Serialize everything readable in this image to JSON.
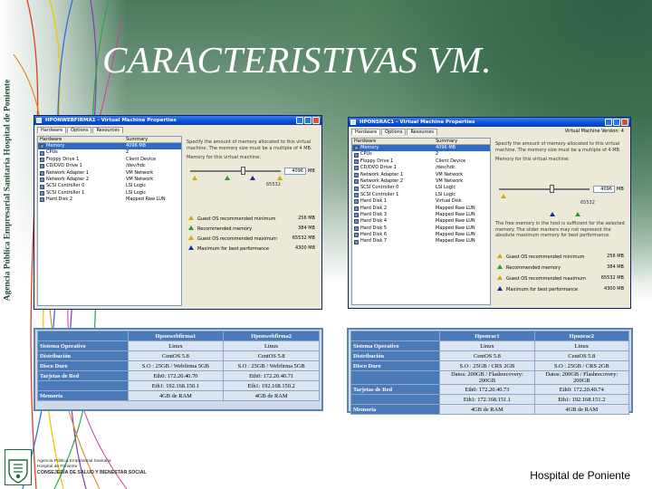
{
  "slide": {
    "title": "CARACTERISTIVAS VM.",
    "vertical_caption": "Agencia Pública Empresarial Sanitaria Hospital de Poniente",
    "footer_right": "Hospital de Poniente",
    "logo": {
      "line1": "Agencia Pública Empresarial Sanitaria",
      "line2": "Hospital de Poniente",
      "line3": "CONSEJERÍA DE SALUD Y BIENESTAR SOCIAL"
    },
    "colors": {
      "background_green": "#3c6e50",
      "table_header_blue": "#4a7ab8",
      "xp_titlebar_blue": "#0a4fd4"
    }
  },
  "vm_left": {
    "window_title": "HPONWEBFIRMA1 - Virtual Machine Properties",
    "tabs": [
      "Hardware",
      "Options",
      "Resources"
    ],
    "columns": [
      "Hardware",
      "Summary"
    ],
    "devices": [
      {
        "name": "Memory",
        "summary": "4096 MB",
        "icon": "memory-icon"
      },
      {
        "name": "CPUs",
        "summary": "2",
        "icon": "cpu-icon"
      },
      {
        "name": "Floppy Drive 1",
        "summary": "Client Device",
        "icon": "floppy-icon"
      },
      {
        "name": "CD/DVD Drive 1",
        "summary": "/dev/hdc",
        "icon": "cdrom-icon"
      },
      {
        "name": "Network Adapter 1",
        "summary": "VM Network",
        "icon": "network-icon"
      },
      {
        "name": "Network Adapter 2",
        "summary": "VM Network",
        "icon": "network-icon"
      },
      {
        "name": "SCSI Controller 0",
        "summary": "LSI Logic",
        "icon": "controller-icon"
      },
      {
        "name": "SCSI Controller 1",
        "summary": "LSI Logic",
        "icon": "controller-icon"
      },
      {
        "name": "Hard Disk 2",
        "summary": "Mapped Raw LUN",
        "icon": "harddisk-icon"
      }
    ],
    "memory_description": "Specify the amount of memory allocated to this virtual machine. The memory size must be a multiple of 4 MB.",
    "memory_for_vm_label": "Memory for this virtual machine:",
    "memory_value": "4096",
    "memory_unit": "MB",
    "slider_max_label": "65532",
    "legend": [
      {
        "label": "Guest OS recommended minimum",
        "value": "256 MB",
        "color": "#c9b000"
      },
      {
        "label": "Recommended memory",
        "value": "384 MB",
        "color": "#2f9b2f"
      },
      {
        "label": "Guest OS recommended maximum",
        "value": "65532 MB",
        "color": "#c9b000"
      },
      {
        "label": "Maximum for best performance",
        "value": "4300 MB",
        "color": "#1a2d8f"
      }
    ]
  },
  "vm_right": {
    "window_title": "HPONSRAC1 - Virtual Machine Properties",
    "tabs": [
      "Hardware",
      "Options",
      "Resources"
    ],
    "version_label": "Virtual Machine Version: 4",
    "columns": [
      "Hardware",
      "Summary"
    ],
    "devices": [
      {
        "name": "Memory",
        "summary": "4096 MB",
        "icon": "memory-icon"
      },
      {
        "name": "CPUs",
        "summary": "2",
        "icon": "cpu-icon"
      },
      {
        "name": "Floppy Drive 1",
        "summary": "Client Device",
        "icon": "floppy-icon"
      },
      {
        "name": "CD/DVD Drive 1",
        "summary": "/dev/hdc",
        "icon": "cdrom-icon"
      },
      {
        "name": "Network Adapter 1",
        "summary": "VM Network",
        "icon": "network-icon"
      },
      {
        "name": "Network Adapter 2",
        "summary": "VM Network",
        "icon": "network-icon"
      },
      {
        "name": "SCSI Controller 0",
        "summary": "LSI Logic",
        "icon": "controller-icon"
      },
      {
        "name": "SCSI Controller 1",
        "summary": "LSI Logic",
        "icon": "controller-icon"
      },
      {
        "name": "Hard Disk 1",
        "summary": "Virtual Disk",
        "icon": "harddisk-icon"
      },
      {
        "name": "Hard Disk 2",
        "summary": "Mapped Raw LUN",
        "icon": "harddisk-icon"
      },
      {
        "name": "Hard Disk 3",
        "summary": "Mapped Raw LUN",
        "icon": "harddisk-icon"
      },
      {
        "name": "Hard Disk 4",
        "summary": "Mapped Raw LUN",
        "icon": "harddisk-icon"
      },
      {
        "name": "Hard Disk 5",
        "summary": "Mapped Raw LUN",
        "icon": "harddisk-icon"
      },
      {
        "name": "Hard Disk 6",
        "summary": "Mapped Raw LUN",
        "icon": "harddisk-icon"
      },
      {
        "name": "Hard Disk 7",
        "summary": "Mapped Raw LUN",
        "icon": "harddisk-icon"
      }
    ],
    "memory_description": "Specify the amount of memory allocated to this virtual machine. The memory size must be a multiple of 4 MB.",
    "memory_for_vm_label": "Memory for this virtual machine:",
    "memory_value": "4096",
    "memory_unit": "MB",
    "slider_max_label": "65532",
    "performance_note": "The free memory in the host is sufficient for the selected memory. The slider markers may not represent the absolute maximum memory for best performance.",
    "legend": [
      {
        "label": "Guest OS recommended minimum",
        "value": "256 MB",
        "color": "#c9b000"
      },
      {
        "label": "Recommended memory",
        "value": "384 MB",
        "color": "#2f9b2f"
      },
      {
        "label": "Guest OS recommended maximum",
        "value": "65532 MB",
        "color": "#c9b000"
      },
      {
        "label": "Maximum for best performance",
        "value": "4300 MB",
        "color": "#1a2d8f"
      }
    ]
  },
  "table_left": {
    "columns": [
      "",
      "Hponwebfirma1",
      "Hponwebfirma2"
    ],
    "rows": [
      {
        "label": "Sistema Operativo",
        "values": [
          "Linux",
          "Linux"
        ]
      },
      {
        "label": "Distribución",
        "values": [
          "CentOS 5.8",
          "CentOS 5.8"
        ]
      },
      {
        "label": "Disco Duro",
        "values": [
          "S.O : 25GB / Webfirma 5GB",
          "S.O : 25GB / Webfirma 5GB"
        ]
      },
      {
        "label": "Tarjetas de Red",
        "values": [
          "Eth0: 172.20.40.70",
          "Eth0: 172.20.40.71"
        ]
      },
      {
        "label": "",
        "values": [
          "Eth1: 192.168.150.1",
          "Eth1: 192.168.150.2"
        ]
      },
      {
        "label": "Memoria",
        "values": [
          "4GB de RAM",
          "4GB de RAM"
        ]
      }
    ]
  },
  "table_right": {
    "columns": [
      "",
      "Hponrac1",
      "Hponrac2"
    ],
    "rows": [
      {
        "label": "Sistema Operativo",
        "values": [
          "Linux",
          "Linux"
        ]
      },
      {
        "label": "Distribución",
        "values": [
          "CentOS 5.8",
          "CentOS 5.8"
        ]
      },
      {
        "label": "Disco Duro",
        "values": [
          "S.O : 25GB / CRS 2GB",
          "S.O : 25GB / CRS 2GB"
        ]
      },
      {
        "label": "",
        "values": [
          "Datos: 200GB / Flashrecovery: 200GB",
          "Datos: 200GB / Flashrecovery: 200GB"
        ]
      },
      {
        "label": "Tarjetas de Red",
        "values": [
          "Eth0: 172.20.40.73",
          "Eth0: 172.20.40.74"
        ]
      },
      {
        "label": "",
        "values": [
          "Eth1: 172.168.151.1",
          "Eth1: 192.168.151.2"
        ]
      },
      {
        "label": "Memoria",
        "values": [
          "4GB de RAM",
          "4GB de RAM"
        ]
      }
    ]
  }
}
